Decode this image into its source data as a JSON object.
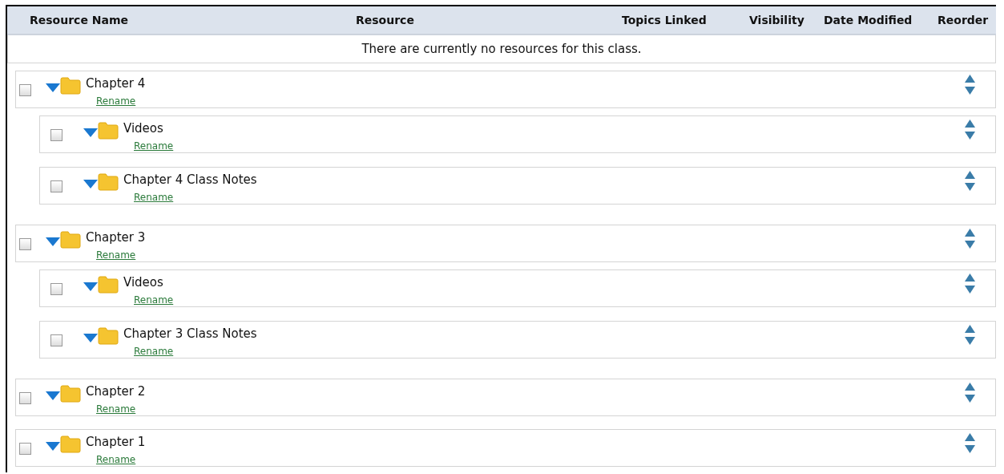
{
  "table": {
    "columns": [
      {
        "label": "Resource Name"
      },
      {
        "label": "Resource"
      },
      {
        "label": "Topics Linked"
      },
      {
        "label": "Visibility"
      },
      {
        "label": "Date Modified"
      },
      {
        "label": "Reorder"
      }
    ],
    "empty_message": "There are currently no resources for this class.",
    "folders": [
      {
        "name": "Chapter 4",
        "link": "Rename",
        "checked": false,
        "expanded": true,
        "children": [
          {
            "name": "Videos",
            "link": "Rename",
            "checked": false,
            "expanded": true
          },
          {
            "name": "Chapter 4 Class Notes",
            "link": "Rename",
            "checked": false,
            "expanded": true
          }
        ]
      },
      {
        "name": "Chapter 3",
        "link": "Rename",
        "checked": false,
        "expanded": true,
        "children": [
          {
            "name": "Videos",
            "link": "Rename",
            "checked": false,
            "expanded": true
          },
          {
            "name": "Chapter 3 Class Notes",
            "link": "Rename",
            "checked": false,
            "expanded": true
          }
        ]
      },
      {
        "name": "Chapter 2",
        "link": "Rename",
        "checked": false,
        "expanded": true
      },
      {
        "name": "Chapter 1",
        "link": "Rename",
        "checked": false,
        "expanded": true
      }
    ]
  }
}
